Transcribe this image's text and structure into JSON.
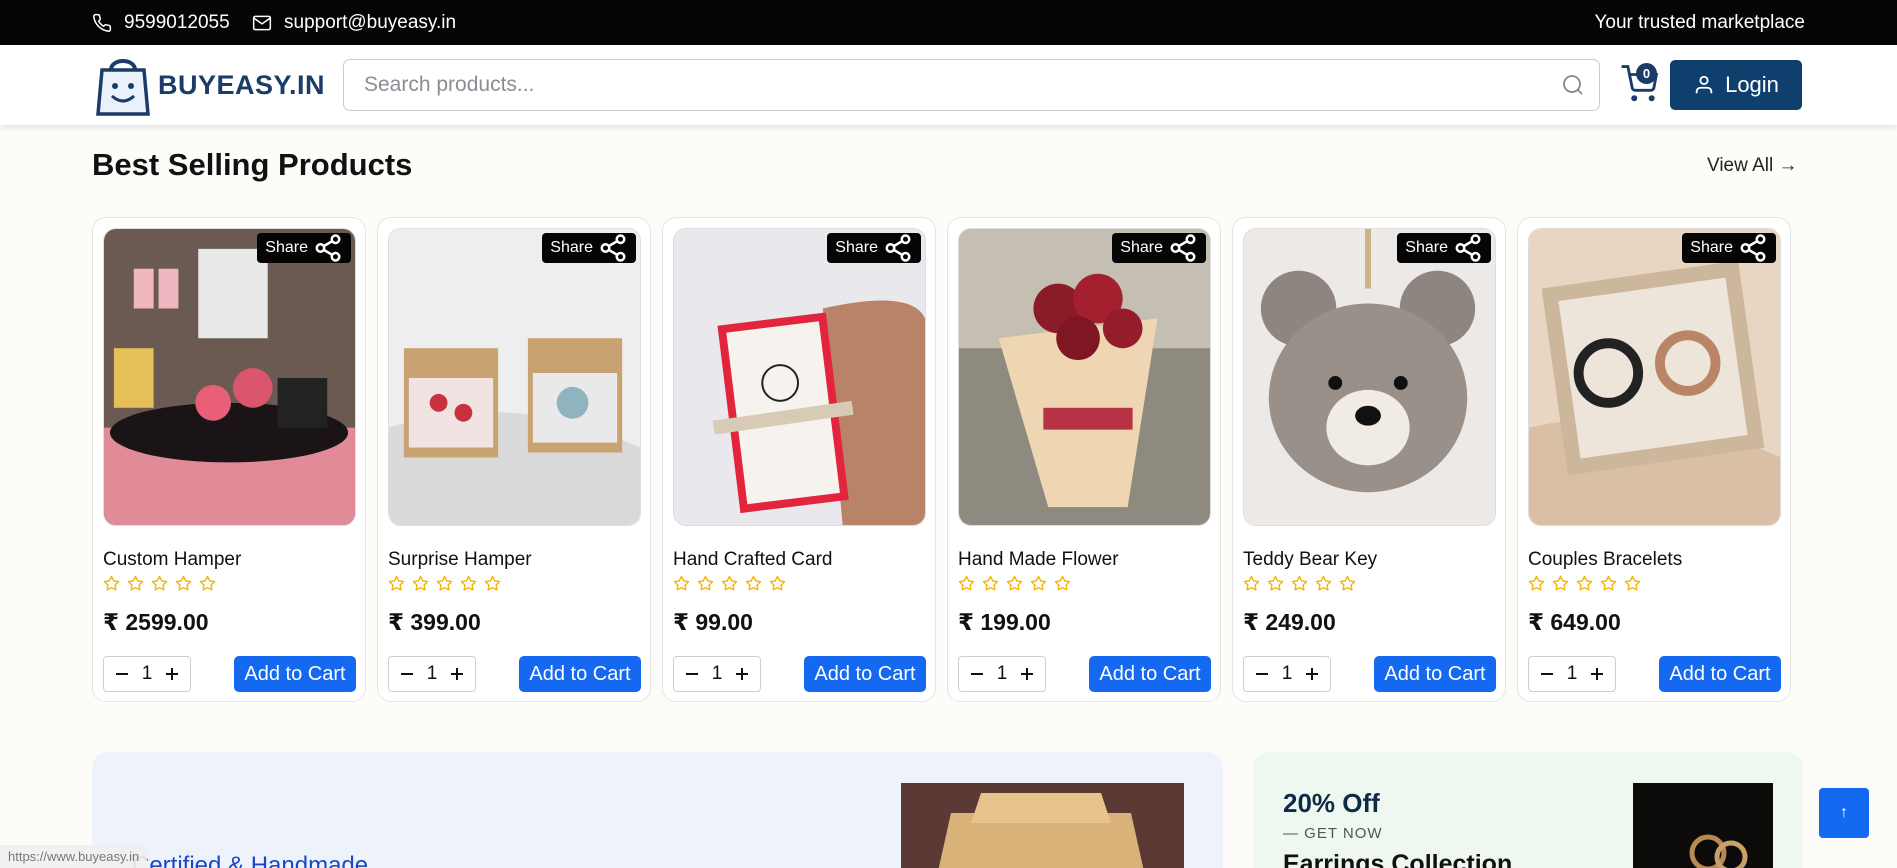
{
  "topbar": {
    "phone": "9599012055",
    "email": "support@buyeasy.in",
    "tagline": "Your trusted marketplace"
  },
  "header": {
    "logo_text": "BUYEASY.IN",
    "search_placeholder": "Search products...",
    "cart_count": "0",
    "login_label": "Login"
  },
  "section": {
    "title": "Best Selling Products",
    "view_all": "View All →"
  },
  "products": [
    {
      "name": "Custom Hamper",
      "price": "₹ 2599.00",
      "qty": "1",
      "share": "Share",
      "add": "Add to Cart",
      "rating": 0
    },
    {
      "name": "Surprise Hamper",
      "price": "₹ 399.00",
      "qty": "1",
      "share": "Share",
      "add": "Add to Cart",
      "rating": 0
    },
    {
      "name": "Hand Crafted Card",
      "price": "₹ 99.00",
      "qty": "1",
      "share": "Share",
      "add": "Add to Cart",
      "rating": 0
    },
    {
      "name": "Hand Made Flower",
      "price": "₹ 199.00",
      "qty": "1",
      "share": "Share",
      "add": "Add to Cart",
      "rating": 0
    },
    {
      "name": "Teddy Bear Key",
      "price": "₹ 249.00",
      "qty": "1",
      "share": "Share",
      "add": "Add to Cart",
      "rating": 0
    },
    {
      "name": "Couples Bracelets",
      "price": "₹ 649.00",
      "qty": "1",
      "share": "Share",
      "add": "Add to Cart",
      "rating": 0
    }
  ],
  "promo_left": {
    "title": "Certified & Handmade"
  },
  "promo_right": {
    "discount": "20% Off",
    "cta": "— GET NOW",
    "collection": "Earrings Collection"
  },
  "scroll_top_label": "↑",
  "status_url": "https://www.buyeasy.in",
  "colors": {
    "primary": "#1469f0",
    "brand": "#1b3c68",
    "star": "#f5b50a"
  }
}
